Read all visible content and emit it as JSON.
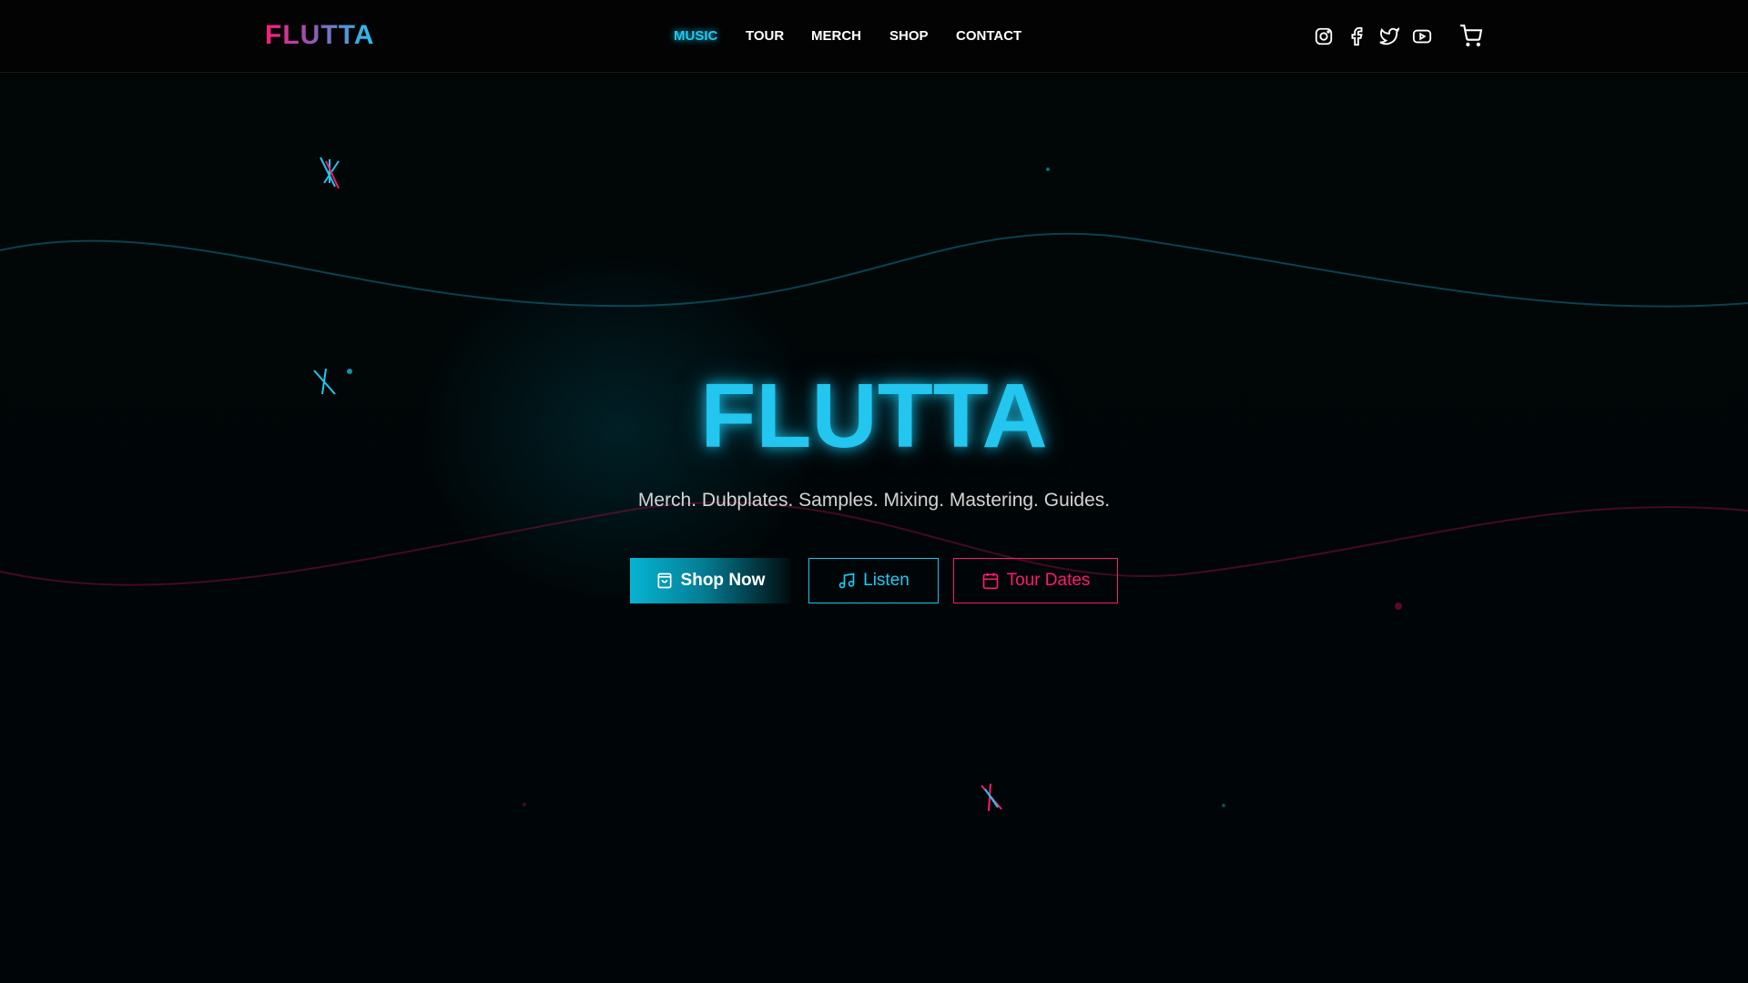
{
  "header": {
    "logo": "FLUTTA",
    "nav": [
      {
        "label": "MUSIC",
        "active": true
      },
      {
        "label": "TOUR"
      },
      {
        "label": "MERCH"
      },
      {
        "label": "SHOP"
      },
      {
        "label": "CONTACT"
      }
    ],
    "icons": [
      "instagram-icon",
      "facebook-icon",
      "twitter-icon",
      "youtube-icon",
      "cart-icon"
    ]
  },
  "hero": {
    "title": "FLUTTA",
    "subtitle": "Merch. Dubplates. Samples. Mixing. Mastering. Guides.",
    "buttons": {
      "shop": "Shop Now",
      "listen": "Listen",
      "tour": "Tour Dates"
    }
  },
  "colors": {
    "cyan": "#1ecbf2",
    "pink": "#ff1a6b",
    "background": "#000000"
  }
}
